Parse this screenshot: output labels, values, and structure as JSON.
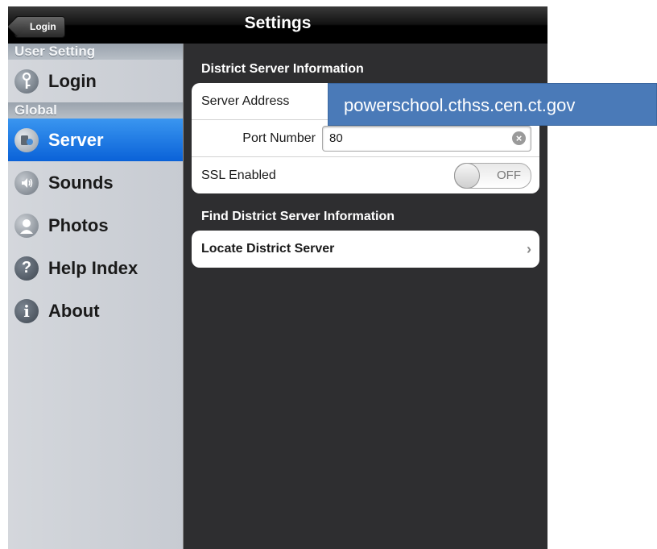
{
  "navbar": {
    "title": "Settings",
    "back_label": "Login"
  },
  "sidebar": {
    "sections": [
      {
        "header": "User Setting",
        "items": [
          {
            "label": "Login",
            "icon": "key-icon"
          }
        ]
      },
      {
        "header": "Global",
        "items": [
          {
            "label": "Server",
            "icon": "server-icon",
            "active": true
          },
          {
            "label": "Sounds",
            "icon": "speaker-icon"
          },
          {
            "label": "Photos",
            "icon": "person-icon"
          },
          {
            "label": "Help Index",
            "icon": "help-icon",
            "glyph": "?"
          },
          {
            "label": "About",
            "icon": "info-icon",
            "glyph": "i"
          }
        ]
      }
    ]
  },
  "main": {
    "group1_title": "District Server Information",
    "server_address_label": "Server Address",
    "port_label": "Port Number",
    "port_value": "80",
    "ssl_label": "SSL Enabled",
    "ssl_state": "OFF",
    "group2_title": "Find District Server Information",
    "locate_label": "Locate District Server"
  },
  "callout": {
    "text": "powerschool.cthss.cen.ct.gov"
  },
  "colors": {
    "active_blue": "#0a62d8",
    "callout_bg": "#4a7ab8"
  }
}
